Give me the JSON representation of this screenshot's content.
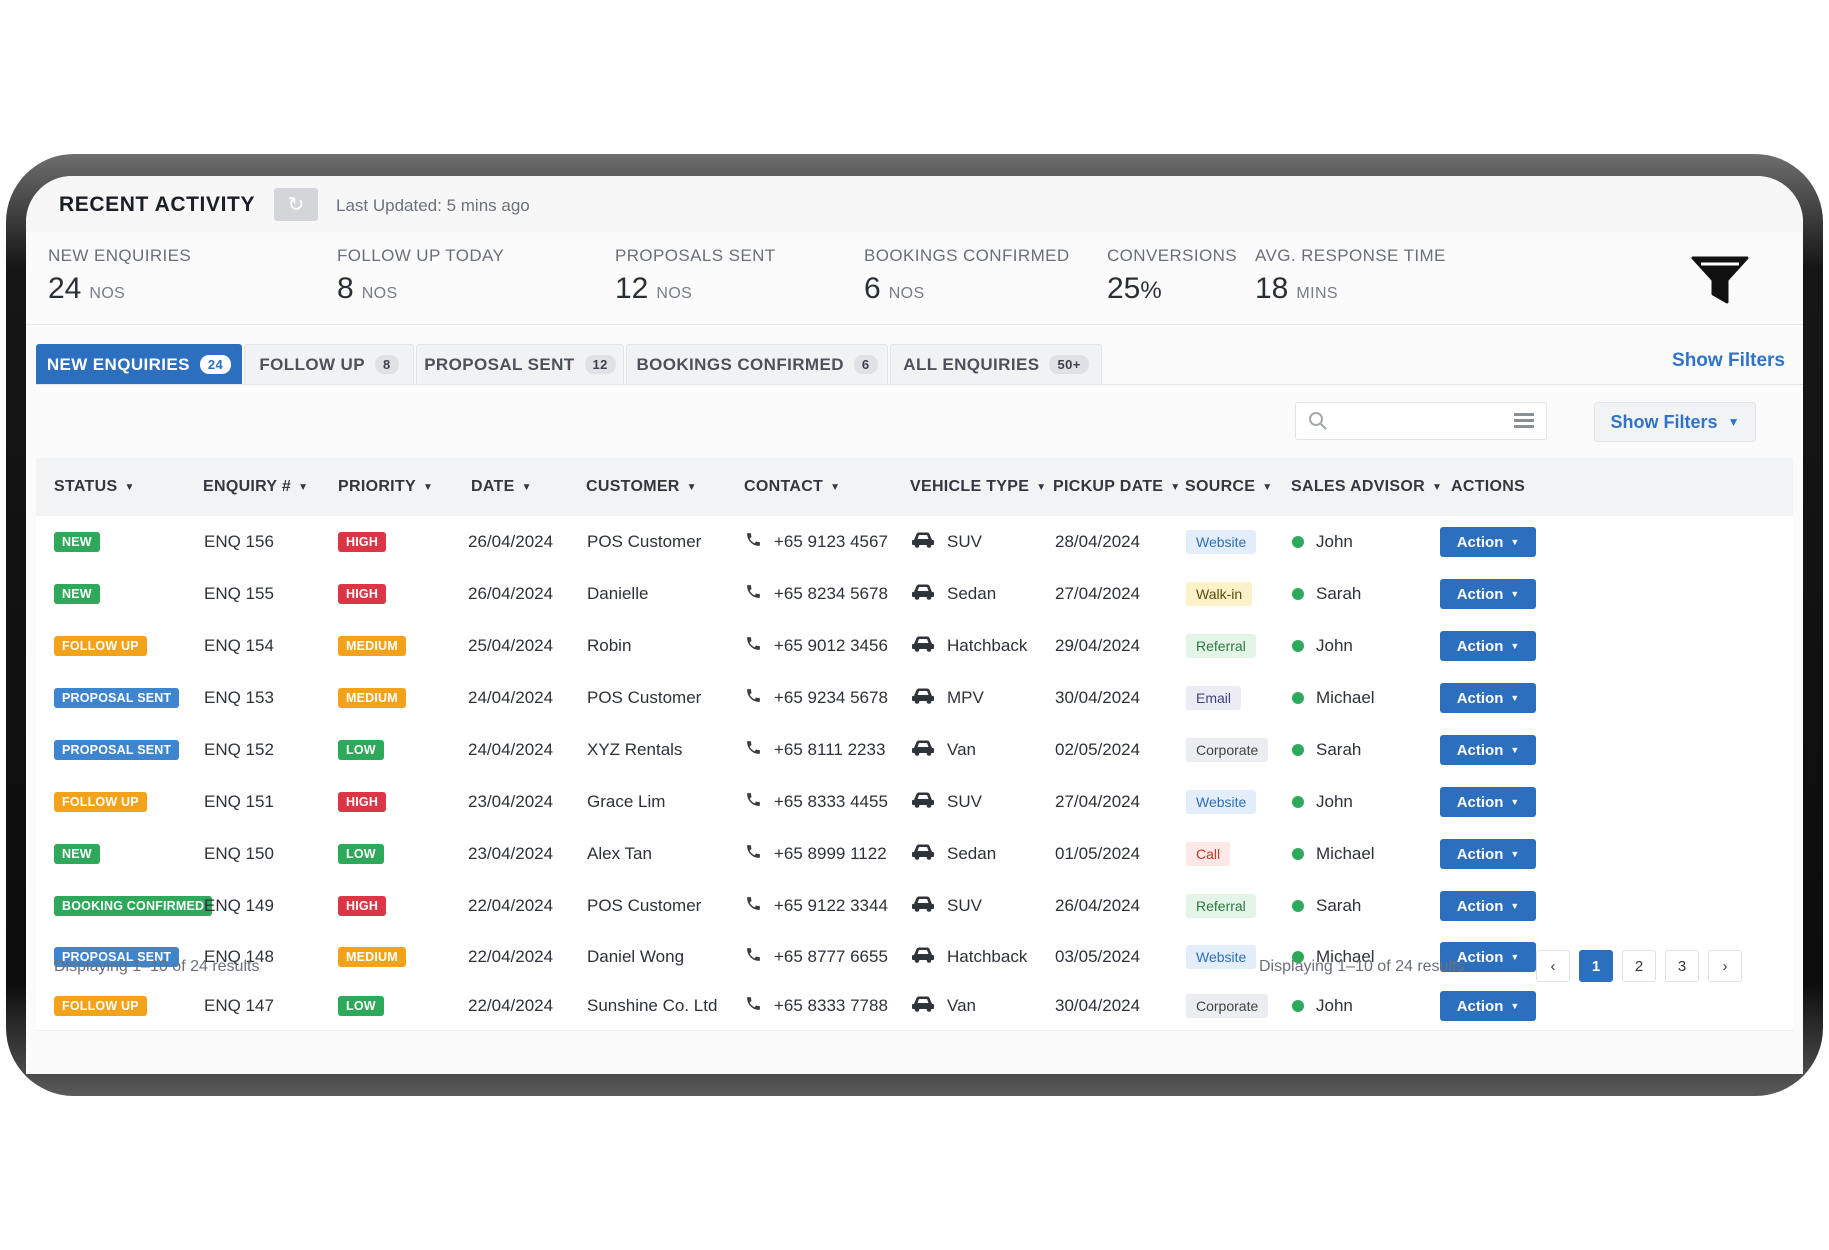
{
  "header": {
    "title": "RECENT ACTIVITY",
    "last_updated": "Last Updated: 5 mins ago"
  },
  "stats": [
    {
      "label": "NEW ENQUIRIES",
      "value": "24",
      "unit": "NOS"
    },
    {
      "label": "FOLLOW UP TODAY",
      "value": "8",
      "unit": "NOS"
    },
    {
      "label": "PROPOSALS SENT",
      "value": "12",
      "unit": "NOS"
    },
    {
      "label": "BOOKINGS CONFIRMED",
      "value": "6",
      "unit": "NOS"
    },
    {
      "label": "CONVERSIONS",
      "value": "25",
      "unit": "%"
    },
    {
      "label": "AVG. RESPONSE TIME",
      "value": "18",
      "unit": "MINS"
    }
  ],
  "tabs": [
    {
      "label": "NEW ENQUIRIES",
      "count": "24"
    },
    {
      "label": "FOLLOW UP",
      "count": "8"
    },
    {
      "label": "PROPOSAL SENT",
      "count": "12"
    },
    {
      "label": "BOOKINGS CONFIRMED",
      "count": "6"
    },
    {
      "label": "ALL ENQUIRIES",
      "count": "50+"
    }
  ],
  "tabs_link": "Show Filters",
  "search": {
    "placeholder": ""
  },
  "filters_button": "Show Filters",
  "columns": [
    "STATUS",
    "ENQUIRY #",
    "PRIORITY",
    "DATE",
    "CUSTOMER",
    "CONTACT",
    "VEHICLE TYPE",
    "PICKUP DATE",
    "SOURCE",
    "SALES ADVISOR",
    "ACTIONS"
  ],
  "rows": [
    {
      "status": "NEW",
      "enquiry": "ENQ 156",
      "priority": "HIGH",
      "date": "26/04/2024",
      "customer": "POS Customer",
      "contact": "+65 9123 4567",
      "vehicle": "SUV",
      "pickup": "28/04/2024",
      "source": "Website",
      "advisor": "John",
      "action": "Action"
    },
    {
      "status": "NEW",
      "enquiry": "ENQ 155",
      "priority": "HIGH",
      "date": "26/04/2024",
      "customer": "Danielle",
      "contact": "+65 8234 5678",
      "vehicle": "Sedan",
      "pickup": "27/04/2024",
      "source": "Walk-in",
      "advisor": "Sarah",
      "action": "Action"
    },
    {
      "status": "FOLLOW UP",
      "enquiry": "ENQ 154",
      "priority": "MEDIUM",
      "date": "25/04/2024",
      "customer": "Robin",
      "contact": "+65 9012 3456",
      "vehicle": "Hatchback",
      "pickup": "29/04/2024",
      "source": "Referral",
      "advisor": "John",
      "action": "Action"
    },
    {
      "status": "PROPOSAL SENT",
      "enquiry": "ENQ 153",
      "priority": "MEDIUM",
      "date": "24/04/2024",
      "customer": "POS Customer",
      "contact": "+65 9234 5678",
      "vehicle": "MPV",
      "pickup": "30/04/2024",
      "source": "Email",
      "advisor": "Michael",
      "action": "Action"
    },
    {
      "status": "PROPOSAL SENT",
      "enquiry": "ENQ 152",
      "priority": "LOW",
      "date": "24/04/2024",
      "customer": "XYZ Rentals",
      "contact": "+65 8111 2233",
      "vehicle": "Van",
      "pickup": "02/05/2024",
      "source": "Corporate",
      "advisor": "Sarah",
      "action": "Action"
    },
    {
      "status": "FOLLOW UP",
      "enquiry": "ENQ 151",
      "priority": "HIGH",
      "date": "23/04/2024",
      "customer": "Grace Lim",
      "contact": "+65 8333 4455",
      "vehicle": "SUV",
      "pickup": "27/04/2024",
      "source": "Website",
      "advisor": "John",
      "action": "Action"
    },
    {
      "status": "NEW",
      "enquiry": "ENQ 150",
      "priority": "LOW",
      "date": "23/04/2024",
      "customer": "Alex Tan",
      "contact": "+65 8999 1122",
      "vehicle": "Sedan",
      "pickup": "01/05/2024",
      "source": "Call",
      "advisor": "Michael",
      "action": "Action"
    },
    {
      "status": "BOOKING CONFIRMED",
      "enquiry": "ENQ 149",
      "priority": "HIGH",
      "date": "22/04/2024",
      "customer": "POS Customer",
      "contact": "+65 9122 3344",
      "vehicle": "SUV",
      "pickup": "26/04/2024",
      "source": "Referral",
      "advisor": "Sarah",
      "action": "Action"
    },
    {
      "status": "PROPOSAL SENT",
      "enquiry": "ENQ 148",
      "priority": "MEDIUM",
      "date": "22/04/2024",
      "customer": "Daniel Wong",
      "contact": "+65 8777 6655",
      "vehicle": "Hatchback",
      "pickup": "03/05/2024",
      "source": "Website",
      "advisor": "Michael",
      "action": "Action"
    },
    {
      "status": "FOLLOW UP",
      "enquiry": "ENQ 147",
      "priority": "LOW",
      "date": "22/04/2024",
      "customer": "Sunshine Co. Ltd",
      "contact": "+65 8333 7788",
      "vehicle": "Van",
      "pickup": "30/04/2024",
      "source": "Corporate",
      "advisor": "John",
      "action": "Action"
    }
  ],
  "footer": {
    "left_text": "Displaying 1–10 of 24 results",
    "right_text": "Displaying 1–10 of 24 results",
    "pages": [
      "1",
      "2",
      "3"
    ],
    "current_page": "1"
  },
  "icons": {
    "refresh": "refresh-icon",
    "funnel": "funnel-icon",
    "search": "search-icon",
    "list": "list-view-icon",
    "phone": "phone-icon",
    "car": "car-icon",
    "prev": "chevron-left-icon",
    "next": "chevron-right-icon"
  },
  "colors": {
    "primary": "#2d6fbf",
    "success": "#2ea85a",
    "warning": "#f5a21b",
    "danger": "#dc3545",
    "info": "#3d86cf"
  }
}
